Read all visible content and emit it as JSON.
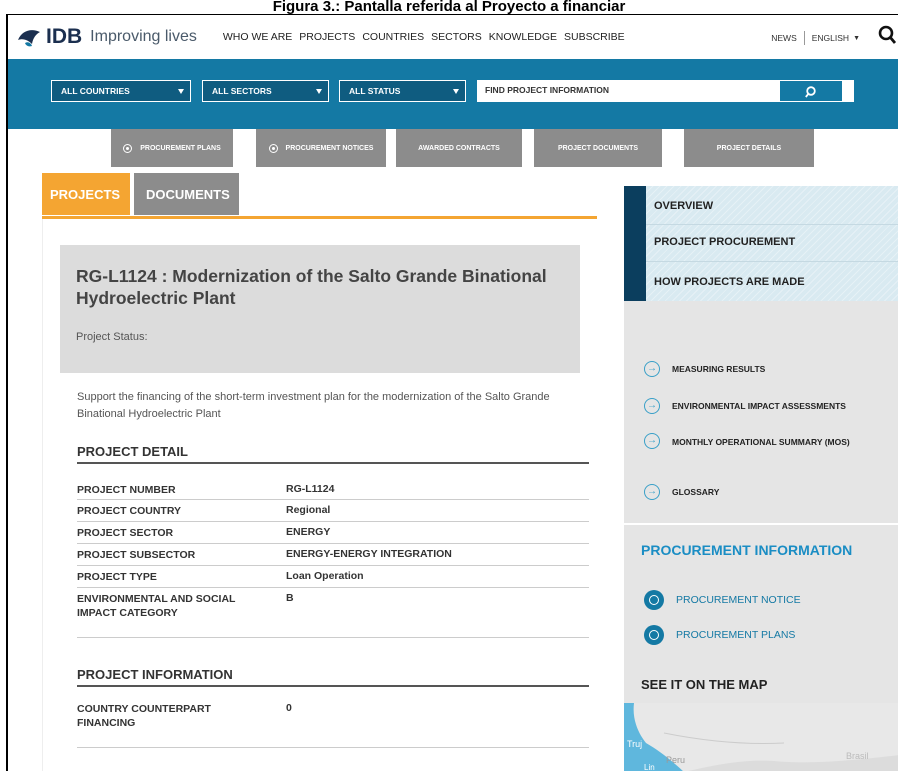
{
  "caption": "Figura 3.: Pantalla referida al Proyecto a financiar",
  "header": {
    "logo_text": "IDB",
    "tagline": "Improving lives",
    "menu": [
      "WHO WE ARE",
      "PROJECTS",
      "COUNTRIES",
      "SECTORS",
      "KNOWLEDGE",
      "SUBSCRIBE"
    ],
    "news": "NEWS",
    "language": "ENGLISH"
  },
  "filters": {
    "countries": "ALL COUNTRIES",
    "sectors": "ALL SECTORS",
    "status": "ALL STATUS",
    "find_placeholder": "FIND PROJECT INFORMATION"
  },
  "subtabs": [
    "PROCUREMENT PLANS",
    "PROCUREMENT NOTICES",
    "AWARDED CONTRACTS",
    "PROJECT DOCUMENTS",
    "PROJECT DETAILS"
  ],
  "tabs": {
    "projects": "PROJECTS",
    "documents": "DOCUMENTS"
  },
  "project": {
    "title": "RG-L1124 : Modernization of the Salto Grande Binational Hydroelectric Plant",
    "status_label": "Project Status:",
    "description": "Support the financing of the short-term investment plan for the modernization of the Salto Grande Binational Hydroelectric Plant"
  },
  "detail": {
    "heading": "PROJECT DETAIL",
    "rows": [
      {
        "key": "PROJECT NUMBER",
        "value": "RG-L1124"
      },
      {
        "key": "PROJECT COUNTRY",
        "value": "Regional"
      },
      {
        "key": "PROJECT SECTOR",
        "value": "ENERGY"
      },
      {
        "key": "PROJECT SUBSECTOR",
        "value": "ENERGY-ENERGY INTEGRATION"
      },
      {
        "key": "PROJECT TYPE",
        "value": "Loan Operation"
      },
      {
        "key": "ENVIRONMENTAL AND SOCIAL IMPACT CATEGORY",
        "value": "B"
      }
    ]
  },
  "information": {
    "heading": "PROJECT INFORMATION",
    "rows": [
      {
        "key": "COUNTRY COUNTERPART FINANCING",
        "value": "0"
      }
    ]
  },
  "sidebar": {
    "nav": [
      "OVERVIEW",
      "PROJECT PROCUREMENT",
      "HOW PROJECTS ARE MADE"
    ],
    "links": [
      "MEASURING RESULTS",
      "ENVIRONMENTAL IMPACT ASSESSMENTS",
      "MONTHLY OPERATIONAL SUMMARY (MOS)",
      "GLOSSARY"
    ],
    "procurement_title": "PROCUREMENT INFORMATION",
    "procurement_links": [
      "PROCUREMENT NOTICE",
      "PROCUREMENT PLANS"
    ],
    "map_title": "SEE IT ON THE MAP",
    "map_labels": [
      "Truj",
      "Peru",
      "Brasil",
      "Lin"
    ]
  },
  "colors": {
    "brand_blue": "#1479a4",
    "tab_orange": "#f4a532",
    "tab_gray": "#8c8c8c",
    "navy": "#0b3e5e"
  }
}
